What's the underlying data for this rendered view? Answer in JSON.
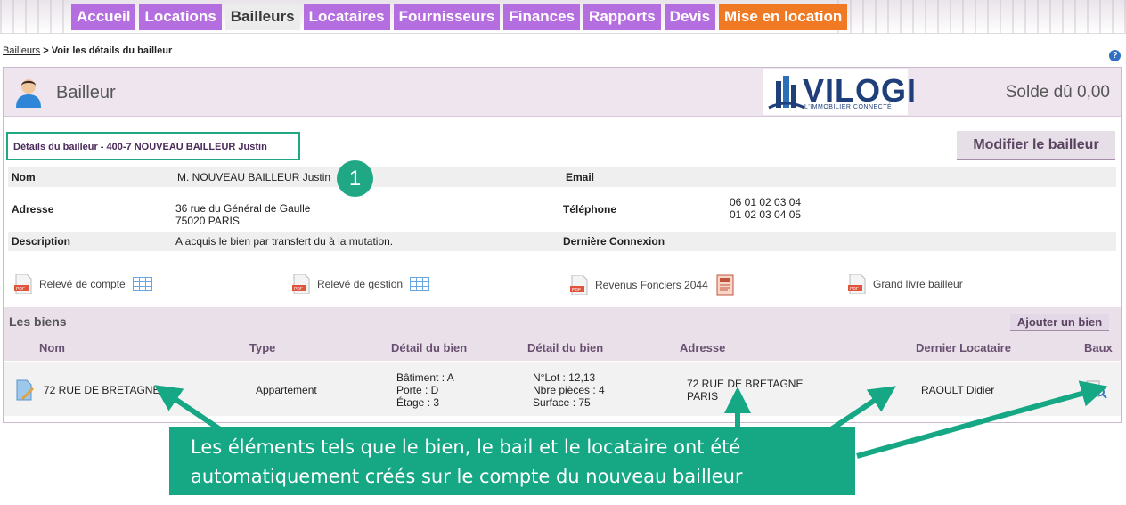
{
  "nav": {
    "tabs": [
      "Accueil",
      "Locations",
      "Bailleurs",
      "Locataires",
      "Fournisseurs",
      "Finances",
      "Rapports",
      "Devis",
      "Mise en location"
    ],
    "active": "Bailleurs",
    "accent": "#b56ee0",
    "orange": "#f07a24"
  },
  "breadcrumb": {
    "link": "Bailleurs",
    "current": " > Voir les détails du bailleur"
  },
  "help_icon": "?",
  "header": {
    "title": "Bailleur",
    "logo_word": "VILOGI",
    "logo_tag": "L'IMMOBILIER CONNECTÉ",
    "balance": "Solde dû 0,00"
  },
  "details": {
    "title": "Détails du bailleur - 400-7 NOUVEAU BAILLEUR Justin",
    "modify_label": "Modifier le bailleur",
    "step_number": "1",
    "fields": {
      "nom_label": "Nom",
      "nom": "M. NOUVEAU BAILLEUR Justin",
      "email_label": "Email",
      "email": "",
      "adresse_label": "Adresse",
      "adresse_1": "36 rue du Général de Gaulle",
      "adresse_2": "75020 PARIS",
      "telephone_label": "Téléphone",
      "telephone_1": "06 01 02 03 04",
      "telephone_2": "01 02 03 04 05",
      "description_label": "Description",
      "description": "A acquis le bien par transfert du à la mutation.",
      "connexion_label": "Dernière Connexion",
      "connexion": ""
    }
  },
  "documents": [
    {
      "label": "Relevé de compte",
      "icon": "pdf-icon",
      "extra": "grid-icon"
    },
    {
      "label": "Relevé de gestion",
      "icon": "pdf-icon",
      "extra": "grid-icon"
    },
    {
      "label": "Revenus Fonciers 2044",
      "icon": "pdf-icon",
      "extra": "tax-icon"
    },
    {
      "label": "Grand livre bailleur",
      "icon": "pdf-icon"
    }
  ],
  "biens": {
    "title": "Les biens",
    "add_label": "Ajouter un bien",
    "columns": [
      "Nom",
      "Type",
      "Détail du bien",
      "Détail du bien",
      "Adresse",
      "Dernier Locataire",
      "Baux"
    ],
    "rows": [
      {
        "nom": "72 RUE DE BRETAGNE",
        "type": "Appartement",
        "detail_1": [
          "Bâtiment : A",
          "Porte : D",
          "Étage : 3"
        ],
        "detail_2": [
          "N°Lot : 12,13",
          "Nbre pièces : 4",
          "Surface : 75"
        ],
        "adresse": [
          "72 RUE DE BRETAGNE",
          "PARIS"
        ],
        "locataire": "RAOULT Didier"
      }
    ]
  },
  "callout": {
    "line1": "Les éléments tels que le bien, le bail et le locataire ont été",
    "line2": "automatiquement créés sur le compte du nouveau bailleur",
    "color": "#16a784"
  }
}
